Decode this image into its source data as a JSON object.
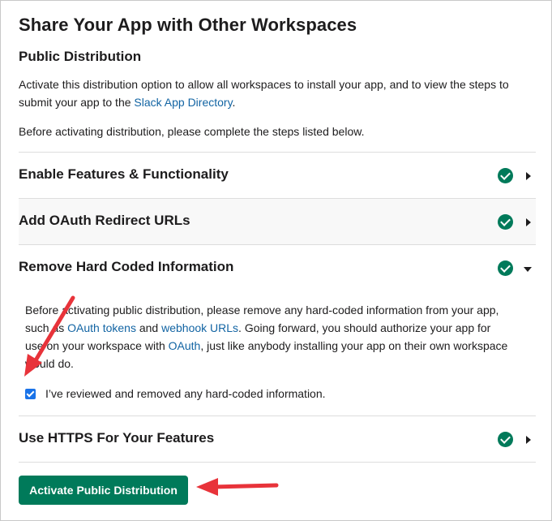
{
  "page": {
    "title": "Share Your App with Other Workspaces",
    "subtitle": "Public Distribution",
    "intro_before_link": "Activate this distribution option to allow all workspaces to install your app, and to view the steps to submit your app to the ",
    "intro_link": "Slack App Directory",
    "intro_after_link": ".",
    "instruction": "Before activating distribution, please complete the steps listed below."
  },
  "steps": [
    {
      "title": "Enable Features & Functionality",
      "status": "complete",
      "expanded": false
    },
    {
      "title": "Add OAuth Redirect URLs",
      "status": "complete",
      "expanded": false
    },
    {
      "title": "Remove Hard Coded Information",
      "status": "complete",
      "expanded": true
    },
    {
      "title": "Use HTTPS For Your Features",
      "status": "complete",
      "expanded": false
    }
  ],
  "hardcoded_section": {
    "text_1": "Before activating public distribution, please remove any hard-coded information from your app, such as ",
    "link_oauth_tokens": "OAuth tokens",
    "text_2": " and ",
    "link_webhook_urls": "webhook URLs",
    "text_3": ". Going forward, you should authorize your app for use on your workspace with ",
    "link_oauth": "OAuth",
    "text_4": ", just like anybody installing your app on their own workspace would do.",
    "checkbox_label": "I’ve reviewed and removed any hard-coded information.",
    "checkbox_checked": true
  },
  "actions": {
    "activate_label": "Activate Public Distribution"
  },
  "colors": {
    "accent_green": "#007a5a",
    "link_blue": "#1264a3",
    "annotation_red": "#e8333a",
    "checkbox_blue": "#1a73e8"
  }
}
